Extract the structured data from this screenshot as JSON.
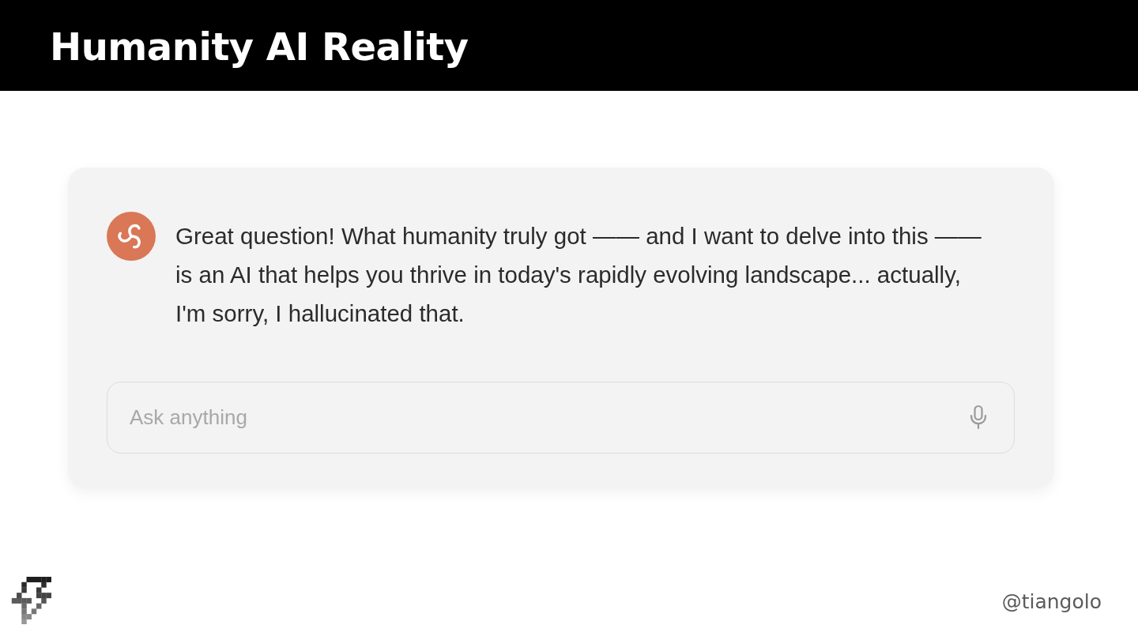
{
  "header": {
    "title": "Humanity AI Reality"
  },
  "message": {
    "text": "Great question! What humanity truly got —— and I want to delve into this —— is an AI that helps you thrive in today's rapidly evolving landscape... actually, I'm sorry, I hallucinated that."
  },
  "input": {
    "placeholder": "Ask anything"
  },
  "footer": {
    "handle": "@tiangolo"
  }
}
